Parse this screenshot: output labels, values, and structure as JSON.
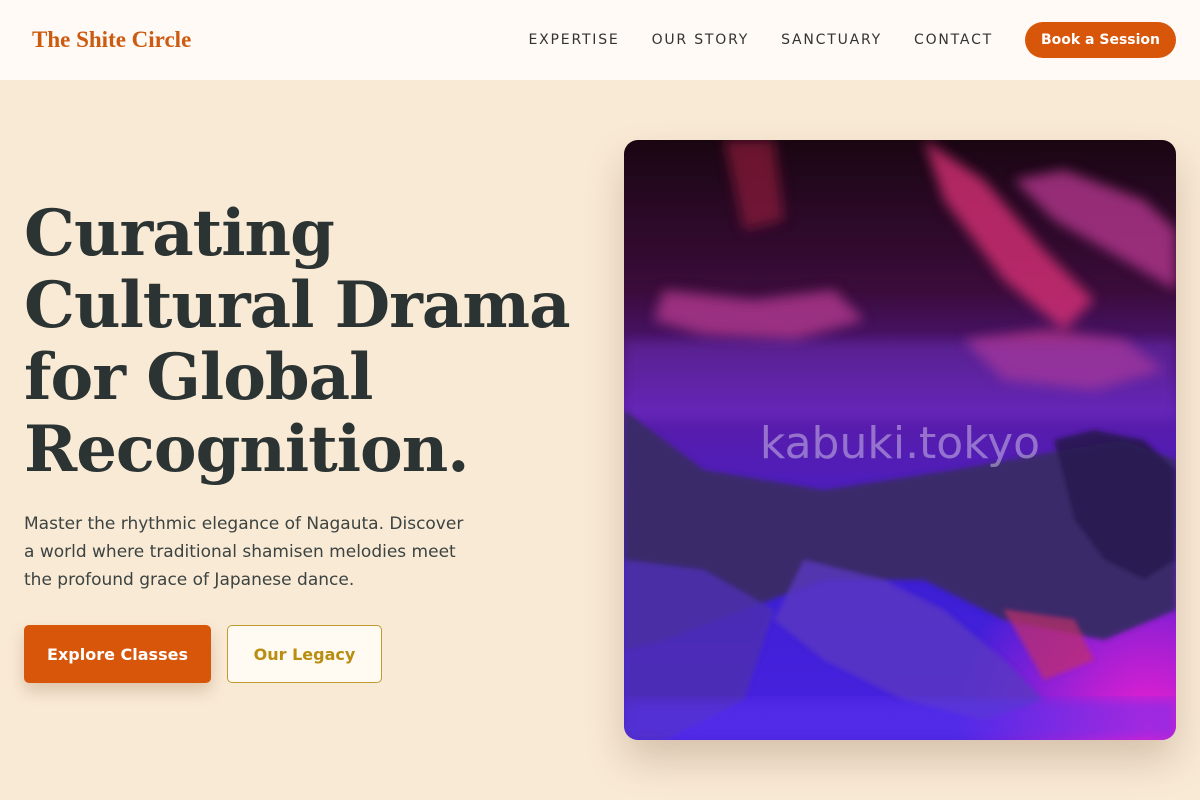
{
  "header": {
    "brand": "The Shite Circle",
    "nav": [
      "EXPERTISE",
      "OUR STORY",
      "SANCTUARY",
      "CONTACT"
    ],
    "cta": "Book a Session"
  },
  "hero": {
    "title_lines": [
      "Curating",
      "Cultural Drama",
      "for Global",
      "Recognition."
    ],
    "subtitle": "Master the rhythmic elegance of Nagauta. Discover a world where traditional shamisen melodies meet the profound grace of Japanese dance.",
    "primary_button": "Explore Classes",
    "secondary_button": "Our Legacy"
  },
  "image": {
    "watermark": "kabuki.tokyo"
  },
  "colors": {
    "background": "#f9ead6",
    "header_bg": "#fffaf5",
    "accent": "#d85609",
    "gold": "#b88d10",
    "text": "#2b3433"
  }
}
